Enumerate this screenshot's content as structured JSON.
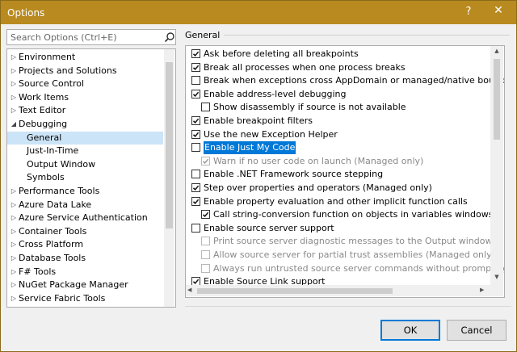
{
  "window": {
    "title": "Options",
    "help_glyph": "?",
    "close_glyph": "✕"
  },
  "search": {
    "placeholder": "Search Options (Ctrl+E)"
  },
  "tree": {
    "items": [
      {
        "label": "Environment",
        "expanded": false
      },
      {
        "label": "Projects and Solutions",
        "expanded": false
      },
      {
        "label": "Source Control",
        "expanded": false
      },
      {
        "label": "Work Items",
        "expanded": false
      },
      {
        "label": "Text Editor",
        "expanded": false
      },
      {
        "label": "Debugging",
        "expanded": true
      },
      {
        "label": "General",
        "child": true,
        "selected": true
      },
      {
        "label": "Just-In-Time",
        "child": true
      },
      {
        "label": "Output Window",
        "child": true
      },
      {
        "label": "Symbols",
        "child": true
      },
      {
        "label": "Performance Tools",
        "expanded": false
      },
      {
        "label": "Azure Data Lake",
        "expanded": false
      },
      {
        "label": "Azure Service Authentication",
        "expanded": false
      },
      {
        "label": "Container Tools",
        "expanded": false
      },
      {
        "label": "Cross Platform",
        "expanded": false
      },
      {
        "label": "Database Tools",
        "expanded": false
      },
      {
        "label": "F# Tools",
        "expanded": false
      },
      {
        "label": "NuGet Package Manager",
        "expanded": false
      },
      {
        "label": "Service Fabric Tools",
        "expanded": false
      }
    ]
  },
  "panel": {
    "title": "General",
    "options": [
      {
        "label": "Ask before deleting all breakpoints",
        "checked": true,
        "indent": 0
      },
      {
        "label": "Break all processes when one process breaks",
        "checked": true,
        "indent": 0
      },
      {
        "label": "Break when exceptions cross AppDomain or managed/native boundaries (",
        "checked": false,
        "indent": 0
      },
      {
        "label": "Enable address-level debugging",
        "checked": true,
        "indent": 0
      },
      {
        "label": "Show disassembly if source is not available",
        "checked": false,
        "indent": 1
      },
      {
        "label": "Enable breakpoint filters",
        "checked": true,
        "indent": 0
      },
      {
        "label": "Use the new Exception Helper",
        "checked": true,
        "indent": 0
      },
      {
        "label": "Enable Just My Code",
        "checked": false,
        "indent": 0,
        "highlighted": true
      },
      {
        "label": "Warn if no user code on launch (Managed only)",
        "checked": true,
        "indent": 1,
        "disabled": true
      },
      {
        "label": "Enable .NET Framework source stepping",
        "checked": false,
        "indent": 0
      },
      {
        "label": "Step over properties and operators (Managed only)",
        "checked": true,
        "indent": 0
      },
      {
        "label": "Enable property evaluation and other implicit function calls",
        "checked": true,
        "indent": 0
      },
      {
        "label": "Call string-conversion function on objects in variables windows",
        "checked": true,
        "indent": 1
      },
      {
        "label": "Enable source server support",
        "checked": false,
        "indent": 0
      },
      {
        "label": "Print source server diagnostic messages to the Output window",
        "checked": false,
        "indent": 1,
        "disabled": true
      },
      {
        "label": "Allow source server for partial trust assemblies (Managed only)",
        "checked": false,
        "indent": 1,
        "disabled": true
      },
      {
        "label": "Always run untrusted source server commands without prompting",
        "checked": false,
        "indent": 1,
        "disabled": true
      },
      {
        "label": "Enable Source Link support",
        "checked": true,
        "indent": 0
      }
    ]
  },
  "buttons": {
    "ok": "OK",
    "cancel": "Cancel"
  },
  "colors": {
    "titlebar": "#b88a1f",
    "accent": "#0078d7",
    "selection": "#cce4f7"
  }
}
